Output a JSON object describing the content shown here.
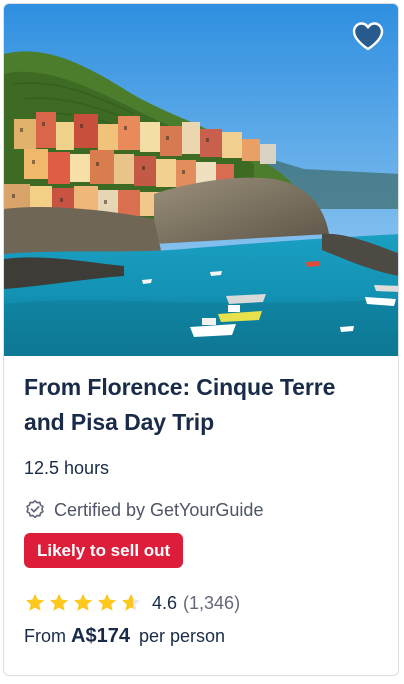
{
  "card": {
    "image": {
      "alt": "Manarola village on cliffs above turquoise sea with boats"
    },
    "wishlist": {
      "icon": "heart-icon"
    },
    "title": "From Florence: Cinque Terre and Pisa Day Trip",
    "duration": "12.5 hours",
    "certified": {
      "icon": "certified-badge-icon",
      "label": "Certified by GetYourGuide"
    },
    "badge": {
      "label": "Likely to sell out",
      "color": "#dc1e3a"
    },
    "rating": {
      "value": 4.6,
      "score_text": "4.6",
      "count_text": "(1,346)",
      "star_color": "#fdc81e"
    },
    "price": {
      "prefix": "From",
      "amount": "A$174",
      "suffix": "per person"
    }
  }
}
